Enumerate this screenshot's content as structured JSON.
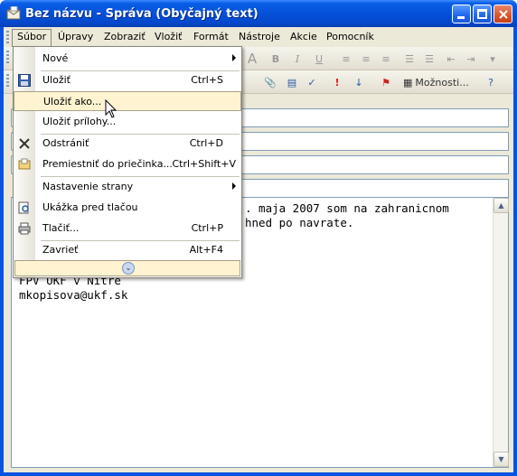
{
  "window": {
    "title": "Bez názvu - Správa (Obyčajný text)"
  },
  "menubar": {
    "items": [
      "Súbor",
      "Úpravy",
      "Zobraziť",
      "Vložiť",
      "Formát",
      "Nástroje",
      "Akcie",
      "Pomocník"
    ]
  },
  "toolbar": {
    "options_label": "Možnosti..."
  },
  "editor": {
    "lines": [
      ". maja 2007 som na zahranicnom",
      "hned po navrate.",
      "",
      "",
      "FPV UKF v Nitre",
      "mkopisova@ukf.sk"
    ]
  },
  "file_menu": {
    "items": [
      {
        "label": "Nové",
        "shortcut": "",
        "submenu": true,
        "icon": ""
      },
      {
        "label": "Uložiť",
        "shortcut": "Ctrl+S",
        "icon": "save-icon"
      },
      {
        "label": "Uložiť ako...",
        "shortcut": "",
        "icon": "",
        "highlighted": true
      },
      {
        "label": "Uložiť prílohy...",
        "shortcut": "",
        "icon": ""
      },
      {
        "label": "Odstrániť",
        "shortcut": "Ctrl+D",
        "icon": "delete-icon"
      },
      {
        "label": "Premiestniť do priečinka...",
        "shortcut": "Ctrl+Shift+V",
        "icon": "move-icon"
      },
      {
        "label": "Nastavenie strany",
        "shortcut": "",
        "submenu": true,
        "icon": ""
      },
      {
        "label": "Ukážka pred tlačou",
        "shortcut": "",
        "icon": "print-preview-icon"
      },
      {
        "label": "Tlačiť...",
        "shortcut": "Ctrl+P",
        "icon": "print-icon"
      },
      {
        "label": "Zavrieť",
        "shortcut": "Alt+F4",
        "icon": ""
      }
    ]
  }
}
